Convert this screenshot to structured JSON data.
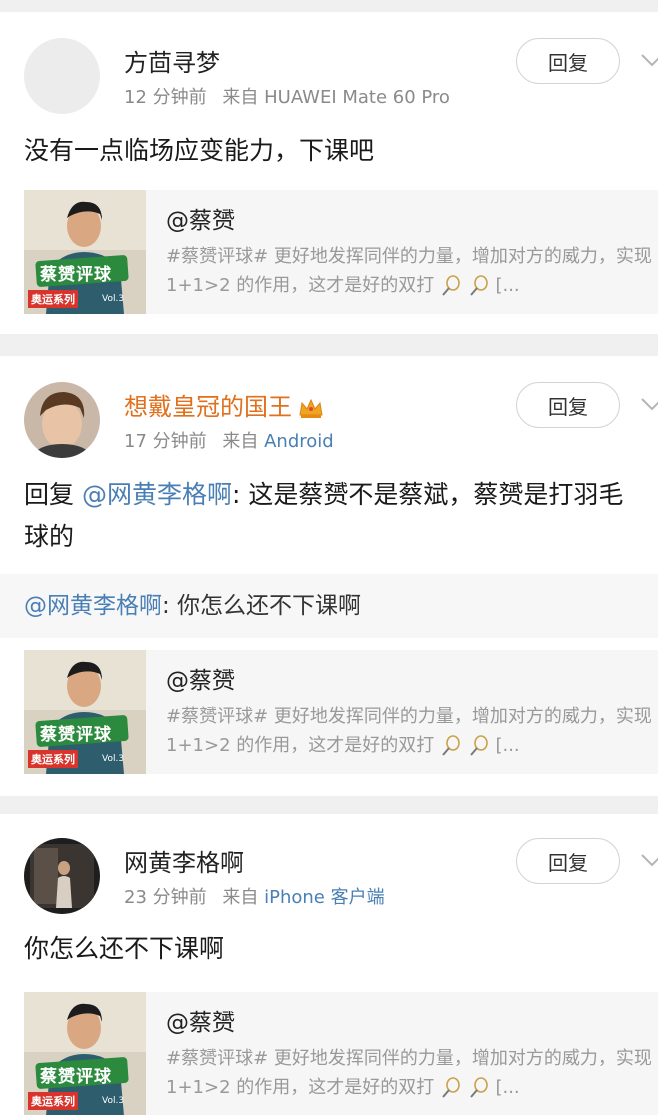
{
  "comments": [
    {
      "user_name": "方茴寻梦",
      "time": "12 分钟前",
      "source_prefix": "来自",
      "source": "HUAWEI Mate 60 Pro",
      "reply_label": "回复",
      "text": "没有一点临场应变能力，下课吧",
      "link_card": {
        "title": "@蔡赟",
        "desc": "#蔡赟评球# 更好地发挥同伴的力量，增加对方的威力，实现 1+1>2 的作用，这才是好的双打",
        "desc_tail": "[...",
        "thumb_badge": "蔡赟评球",
        "thumb_tag": "奥运系列",
        "thumb_vol": "Vol.3"
      }
    },
    {
      "user_name": "想戴皇冠的国王",
      "name_icon": "crown-icon",
      "time": "17 分钟前",
      "source_prefix": "来自",
      "source": "Android",
      "reply_label": "回复",
      "text_prefix": "回复",
      "text_mention": "@网黄李格啊",
      "text_body": ": 这是蔡赟不是蔡斌，蔡赟是打羽毛球的",
      "quote_mention": "@网黄李格啊",
      "quote_body": ": 你怎么还不下课啊",
      "link_card": {
        "title": "@蔡赟",
        "desc": "#蔡赟评球# 更好地发挥同伴的力量，增加对方的威力，实现 1+1>2 的作用，这才是好的双打",
        "desc_tail": "[...",
        "thumb_badge": "蔡赟评球",
        "thumb_tag": "奥运系列",
        "thumb_vol": "Vol.3"
      }
    },
    {
      "user_name": "网黄李格啊",
      "time": "23 分钟前",
      "source_prefix": "来自",
      "source": "iPhone 客户端",
      "reply_label": "回复",
      "text": "你怎么还不下课啊",
      "link_card": {
        "title": "@蔡赟",
        "desc": "#蔡赟评球# 更好地发挥同伴的力量，增加对方的威力，实现 1+1>2 的作用，这才是好的双打",
        "desc_tail": "[...",
        "thumb_badge": "蔡赟评球",
        "thumb_tag": "奥运系列",
        "thumb_vol": "Vol.3"
      }
    }
  ],
  "colors": {
    "link": "#4a7fb5",
    "vip_name": "#e0701c",
    "meta": "#8a8a8a",
    "page_bg": "#f0f0f0"
  }
}
